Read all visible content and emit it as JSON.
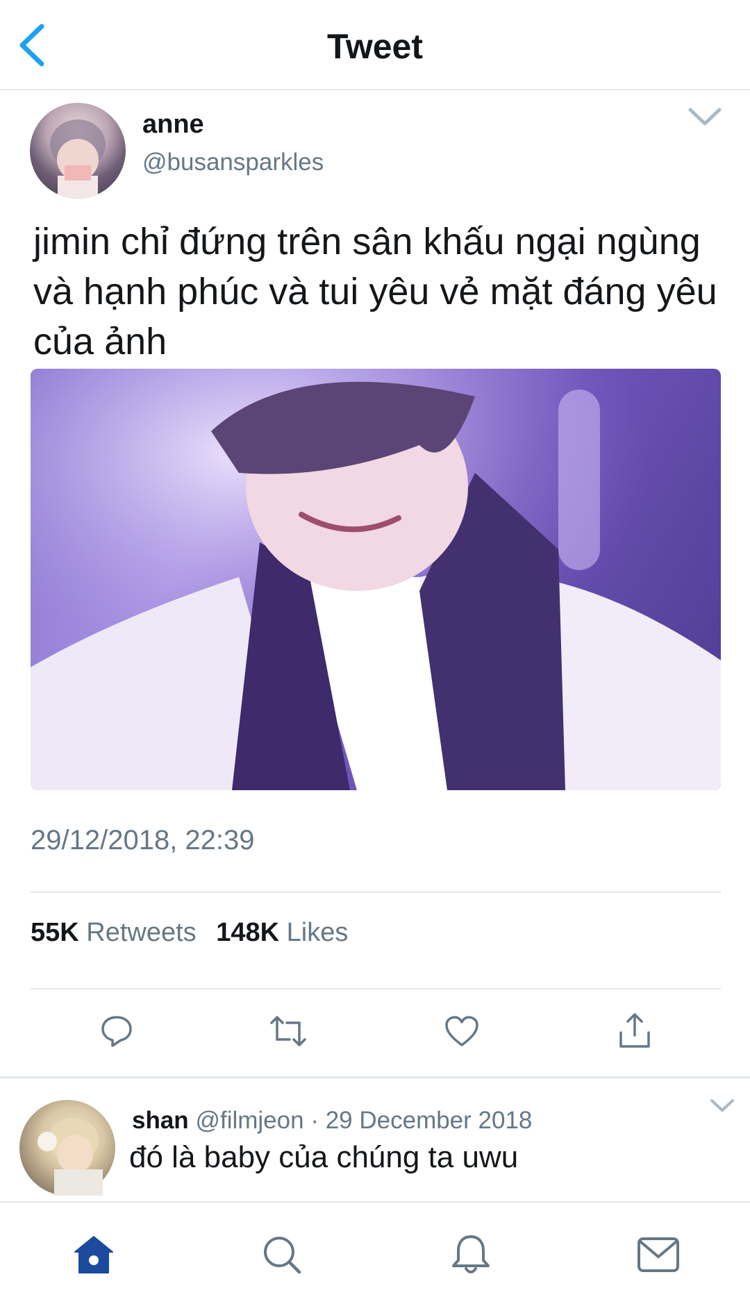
{
  "header": {
    "title": "Tweet"
  },
  "tweet": {
    "display_name": "anne",
    "handle": "@busansparkles",
    "text": "jimin chỉ đứng trên sân khấu ngại ngùng và hạnh phúc và tui yêu vẻ mặt đáng yêu của ảnh",
    "timestamp": "29/12/2018, 22:39",
    "retweets_count": "55K",
    "retweets_label": "Retweets",
    "likes_count": "148K",
    "likes_label": "Likes"
  },
  "actions": [
    "reply-icon",
    "retweet-icon",
    "like-icon",
    "share-icon"
  ],
  "reply": {
    "name": "shan",
    "handle": "@filmjeon",
    "separator": "·",
    "date": "29 December 2018",
    "text": "đó là baby của chúng ta uwu"
  },
  "tabbar": {
    "tabs": [
      "home-icon",
      "search-icon",
      "notifications-icon",
      "messages-icon"
    ],
    "active": "home"
  },
  "colors": {
    "accent": "#1da1f2",
    "muted": "#657786",
    "divider": "#e1e8ed",
    "active_tab": "#1c4b9e"
  }
}
